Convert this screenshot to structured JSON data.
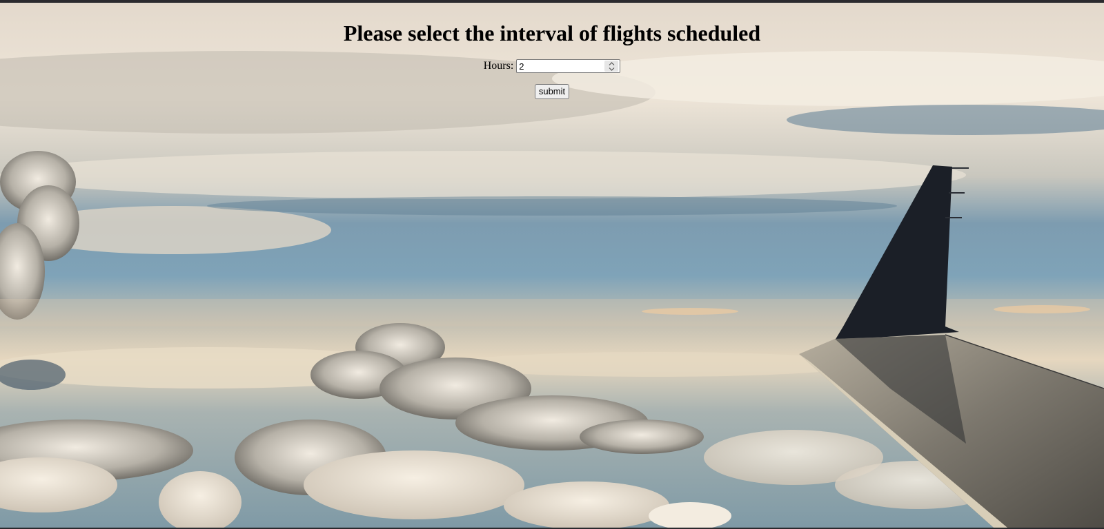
{
  "page": {
    "heading": "Please select the interval of flights scheduled"
  },
  "form": {
    "hours_label": "Hours:",
    "hours_value": "2",
    "submit_label": "submit"
  },
  "background": {
    "description_icon": "sky-with-airplane-wing-image",
    "colors": {
      "sky_top": "#ece4d9",
      "sky_mid": "#6f97ae",
      "horizon": "#e9dccb",
      "wingtip": "#1a1e26",
      "wing": "#8a8579"
    }
  }
}
